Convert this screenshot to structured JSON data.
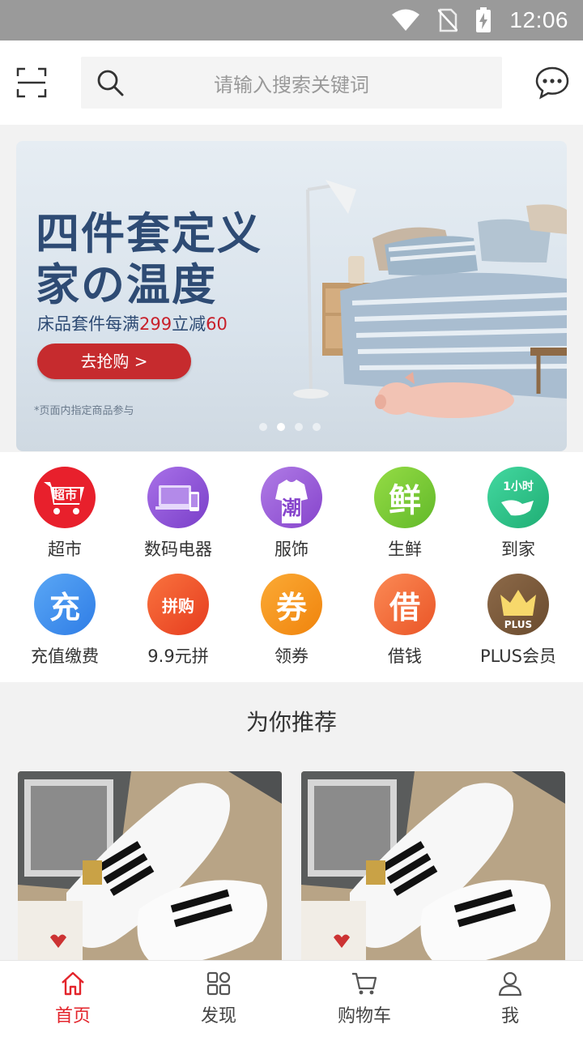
{
  "status_bar": {
    "time": "12:06"
  },
  "search": {
    "placeholder": "请输入搜索关键词"
  },
  "banner": {
    "title_line1": "四件套定义",
    "title_line2": "家の温度",
    "subtitle_prefix": "床品套件每满",
    "subtitle_amount1": "299",
    "subtitle_middle": "立减",
    "subtitle_amount2": "60",
    "cta_label": "去抢购 >",
    "note": "*页面内指定商品参与",
    "active_slide": 2,
    "slide_count": 4
  },
  "categories": [
    {
      "label": "超市",
      "icon": "supermarket-cart-icon",
      "icon_text": "超市",
      "color": "#e8202c"
    },
    {
      "label": "数码电器",
      "icon": "computer-phone-icon",
      "color": "#8e4fd6"
    },
    {
      "label": "服饰",
      "icon": "clothing-icon",
      "icon_text": "潮",
      "color": "#9b5fd6"
    },
    {
      "label": "生鲜",
      "icon": "fresh-food-icon",
      "icon_text": "鲜",
      "color": "#7dc832"
    },
    {
      "label": "到家",
      "icon": "delivery-icon",
      "icon_text": "1小时",
      "color": "#2dc58a"
    },
    {
      "label": "充值缴费",
      "icon": "recharge-icon",
      "icon_text": "充",
      "color": "#3d8ff0"
    },
    {
      "label": "9.9元拼",
      "icon": "group-buy-icon",
      "icon_text": "拼购",
      "color": "#f0502c"
    },
    {
      "label": "领券",
      "icon": "coupon-icon",
      "icon_text": "券",
      "color": "#f5961e"
    },
    {
      "label": "借钱",
      "icon": "borrow-money-icon",
      "icon_text": "借",
      "color": "#f26a3a"
    },
    {
      "label": "PLUS会员",
      "icon": "plus-member-crown-icon",
      "icon_text": "PLUS",
      "color": "#7a5a3c"
    }
  ],
  "recommend": {
    "title": "为你推荐"
  },
  "tabs": [
    {
      "label": "首页",
      "icon": "home-icon",
      "active": true
    },
    {
      "label": "发现",
      "icon": "discover-grid-icon",
      "active": false
    },
    {
      "label": "购物车",
      "icon": "cart-icon",
      "active": false
    },
    {
      "label": "我",
      "icon": "profile-icon",
      "active": false
    }
  ],
  "colors": {
    "accent": "#e3242b",
    "banner_title": "#2e4b74",
    "status_bar": "#9a9a9a"
  }
}
